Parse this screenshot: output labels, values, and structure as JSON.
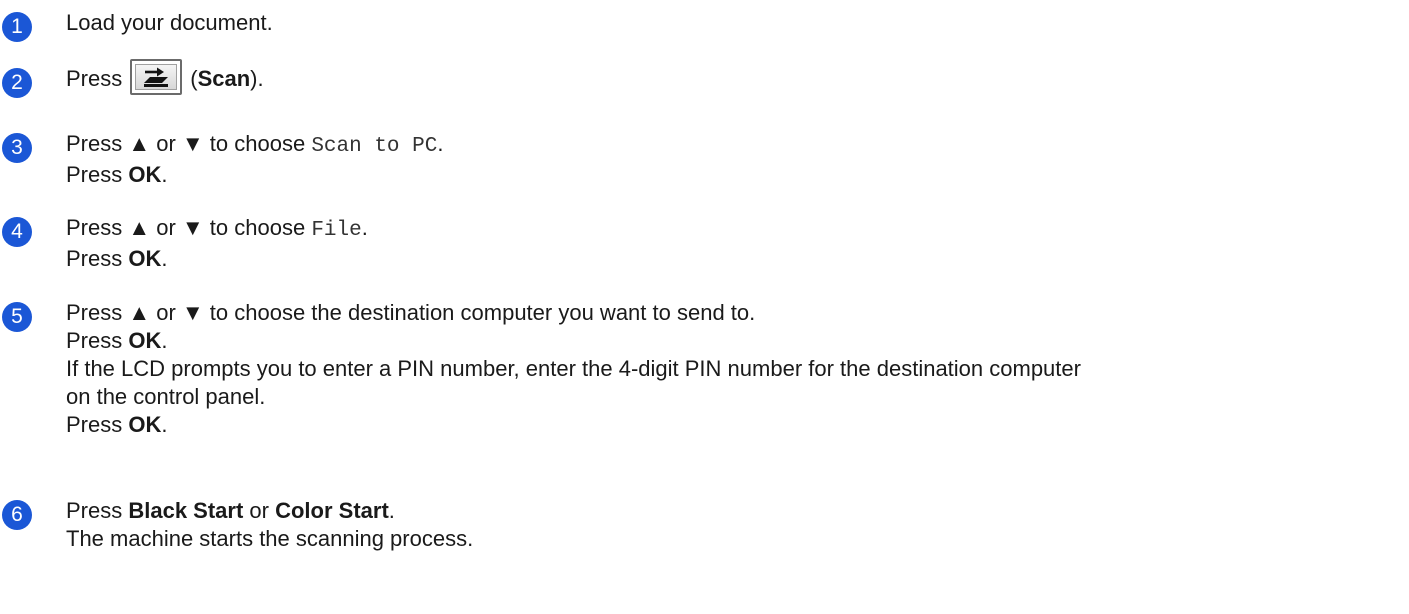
{
  "steps": [
    {
      "number": "1",
      "lines": [
        {
          "text": "Load your document."
        }
      ]
    },
    {
      "number": "2",
      "press": "Press",
      "open_paren": "(",
      "key_label": "Scan",
      "close_paren": ").",
      "icon": "scan-key-icon"
    },
    {
      "number": "3",
      "lines": [
        {
          "pre": "Press ▲ or ▼ to choose ",
          "mono": "Scan to PC",
          "post": "."
        },
        {
          "pre": "Press ",
          "bold": "OK",
          "post": "."
        }
      ]
    },
    {
      "number": "4",
      "lines": [
        {
          "pre": "Press ▲ or ▼ to choose ",
          "mono": "File",
          "post": "."
        },
        {
          "pre": "Press ",
          "bold": "OK",
          "post": "."
        }
      ]
    },
    {
      "number": "5",
      "lines": [
        {
          "text": "Press ▲ or ▼ to choose the destination computer you want to send to."
        },
        {
          "pre": "Press ",
          "bold": "OK",
          "post": "."
        },
        {
          "text": "If the LCD prompts you to enter a PIN number, enter the 4-digit PIN number for the destination computer"
        },
        {
          "text": "on the control panel."
        },
        {
          "pre": "Press ",
          "bold": "OK",
          "post": "."
        }
      ]
    },
    {
      "number": "6",
      "lines": [
        {
          "pre": "Press ",
          "bold": "Black Start",
          "mid": " or ",
          "bold2": "Color Start",
          "post": "."
        },
        {
          "text": "The machine starts the scanning process."
        }
      ]
    }
  ],
  "colors": {
    "badge": "#1b57d6",
    "text": "#1a1a1a"
  }
}
